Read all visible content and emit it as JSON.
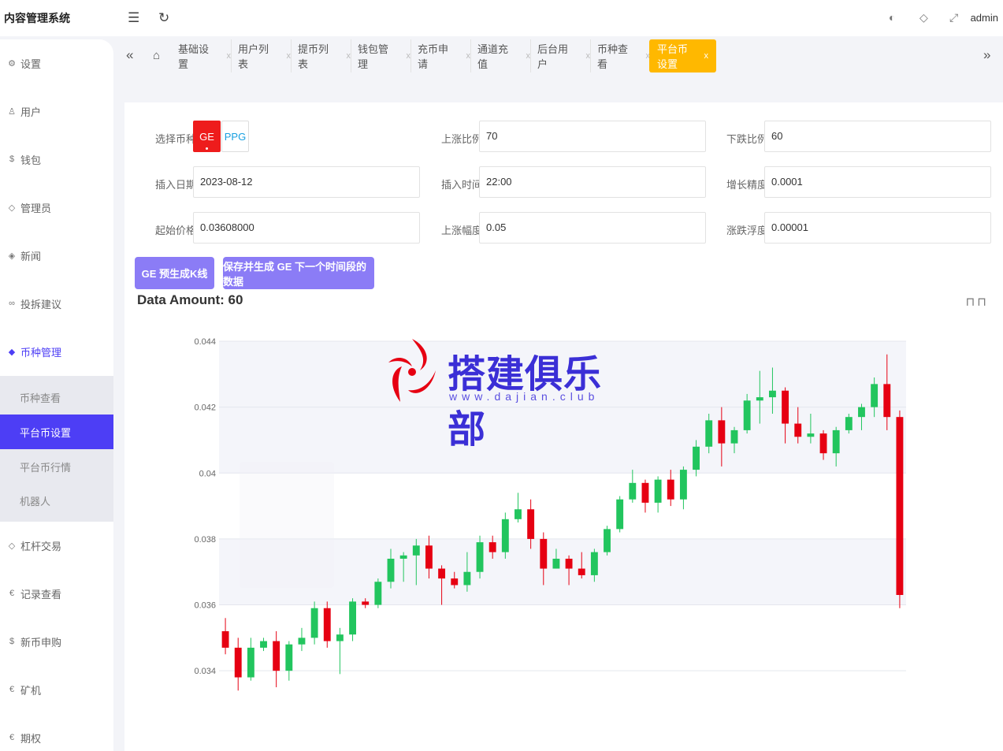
{
  "header": {
    "brand": "内容管理系统",
    "menu_icon": "☰",
    "refresh_icon": "↻",
    "user": "admin"
  },
  "sidebar": {
    "items": [
      {
        "label": "设置",
        "icon": "gear-icon",
        "glyph": "⚙"
      },
      {
        "label": "用户",
        "icon": "user-icon",
        "glyph": "♙"
      },
      {
        "label": "钱包",
        "icon": "wallet-icon",
        "glyph": "$"
      },
      {
        "label": "管理员",
        "icon": "shield-icon",
        "glyph": "◇"
      },
      {
        "label": "新闻",
        "icon": "tag-icon",
        "glyph": "◈"
      },
      {
        "label": "投拆建议",
        "icon": "link-icon",
        "glyph": "∞"
      },
      {
        "label": "币种管理",
        "icon": "diamond-icon",
        "glyph": "◆"
      },
      {
        "label": "杠杆交易",
        "icon": "diamond-outline-icon",
        "glyph": "◇"
      },
      {
        "label": "记录查看",
        "icon": "coin-icon",
        "glyph": "€"
      },
      {
        "label": "新币申购",
        "icon": "dollar-icon",
        "glyph": "$"
      },
      {
        "label": "矿机",
        "icon": "coin-icon",
        "glyph": "€"
      },
      {
        "label": "期权",
        "icon": "coin-icon",
        "glyph": "€"
      }
    ],
    "submenu": [
      "币种查看",
      "平台币设置",
      "平台币行情",
      "机器人"
    ]
  },
  "tabs": [
    "基础设置",
    "用户列表",
    "提币列表",
    "钱包管理",
    "充币申请",
    "通道充值",
    "后台用户",
    "币种查看",
    "平台币设置"
  ],
  "form": {
    "coin_label": "选择币种",
    "coin_ge": "GE",
    "coin_ppg": "PPG",
    "up_ratio_label": "上涨比例",
    "up_ratio": "70",
    "down_ratio_label": "下跌比例",
    "down_ratio": "60",
    "date_label": "插入日期",
    "date": "2023-08-12",
    "time_label": "插入时间",
    "time": "22:00",
    "precision_label": "增长精度",
    "precision": "0.0001",
    "start_price_label": "起始价格",
    "start_price": "0.03608000",
    "rise_label": "上涨幅度",
    "rise": "0.05",
    "float_label": "涨跌浮度",
    "float": "0.00001"
  },
  "buttons": {
    "pre_generate": "GE 预生成K线",
    "save_generate": "保存并生成 GE 下一个时间段的数据"
  },
  "data_amount": "Data Amount: 60",
  "watermark": {
    "text": "搭建俱乐部",
    "url": "www.dajian.club"
  },
  "colors": {
    "accent": "#4d3ef5",
    "tab_active": "#ffb800",
    "up": "#22c55e",
    "down": "#e60012",
    "button": "#8b7cf6"
  },
  "chart_data": {
    "type": "candlestick",
    "ylim": [
      0.033,
      0.044
    ],
    "y_ticks": [
      "0.044",
      "0.042",
      "0.04",
      "0.038",
      "0.036",
      "0.034"
    ],
    "candles": [
      {
        "o": 0.0352,
        "c": 0.0347,
        "h": 0.0356,
        "l": 0.0345
      },
      {
        "o": 0.0347,
        "c": 0.0338,
        "h": 0.035,
        "l": 0.0334
      },
      {
        "o": 0.0338,
        "c": 0.0347,
        "h": 0.035,
        "l": 0.0337
      },
      {
        "o": 0.0347,
        "c": 0.0349,
        "h": 0.035,
        "l": 0.0346
      },
      {
        "o": 0.0349,
        "c": 0.034,
        "h": 0.0352,
        "l": 0.0335
      },
      {
        "o": 0.034,
        "c": 0.0348,
        "h": 0.0349,
        "l": 0.0337
      },
      {
        "o": 0.0348,
        "c": 0.035,
        "h": 0.0353,
        "l": 0.0346
      },
      {
        "o": 0.035,
        "c": 0.0359,
        "h": 0.0361,
        "l": 0.0348
      },
      {
        "o": 0.0359,
        "c": 0.0349,
        "h": 0.0361,
        "l": 0.0347
      },
      {
        "o": 0.0349,
        "c": 0.0351,
        "h": 0.0353,
        "l": 0.0339
      },
      {
        "o": 0.0351,
        "c": 0.0361,
        "h": 0.0362,
        "l": 0.0349
      },
      {
        "o": 0.0361,
        "c": 0.036,
        "h": 0.0362,
        "l": 0.0359
      },
      {
        "o": 0.036,
        "c": 0.0367,
        "h": 0.0368,
        "l": 0.0359
      },
      {
        "o": 0.0367,
        "c": 0.0374,
        "h": 0.0377,
        "l": 0.0365
      },
      {
        "o": 0.0374,
        "c": 0.0375,
        "h": 0.0376,
        "l": 0.0367
      },
      {
        "o": 0.0375,
        "c": 0.0378,
        "h": 0.038,
        "l": 0.0366
      },
      {
        "o": 0.0378,
        "c": 0.0371,
        "h": 0.0381,
        "l": 0.0368
      },
      {
        "o": 0.0371,
        "c": 0.0368,
        "h": 0.0372,
        "l": 0.036
      },
      {
        "o": 0.0368,
        "c": 0.0366,
        "h": 0.037,
        "l": 0.0365
      },
      {
        "o": 0.0366,
        "c": 0.037,
        "h": 0.0376,
        "l": 0.0364
      },
      {
        "o": 0.037,
        "c": 0.0379,
        "h": 0.0381,
        "l": 0.0368
      },
      {
        "o": 0.0379,
        "c": 0.0376,
        "h": 0.0381,
        "l": 0.0374
      },
      {
        "o": 0.0376,
        "c": 0.0386,
        "h": 0.0388,
        "l": 0.0374
      },
      {
        "o": 0.0386,
        "c": 0.0389,
        "h": 0.0394,
        "l": 0.0385
      },
      {
        "o": 0.0389,
        "c": 0.038,
        "h": 0.0392,
        "l": 0.0377
      },
      {
        "o": 0.038,
        "c": 0.0371,
        "h": 0.0382,
        "l": 0.0366
      },
      {
        "o": 0.0371,
        "c": 0.0374,
        "h": 0.0377,
        "l": 0.0371
      },
      {
        "o": 0.0374,
        "c": 0.0371,
        "h": 0.0375,
        "l": 0.0366
      },
      {
        "o": 0.0371,
        "c": 0.0369,
        "h": 0.0376,
        "l": 0.0368
      },
      {
        "o": 0.0369,
        "c": 0.0376,
        "h": 0.0377,
        "l": 0.0367
      },
      {
        "o": 0.0376,
        "c": 0.0383,
        "h": 0.0384,
        "l": 0.0375
      },
      {
        "o": 0.0383,
        "c": 0.0392,
        "h": 0.0393,
        "l": 0.0382
      },
      {
        "o": 0.0392,
        "c": 0.0397,
        "h": 0.0401,
        "l": 0.0391
      },
      {
        "o": 0.0397,
        "c": 0.0391,
        "h": 0.0398,
        "l": 0.0388
      },
      {
        "o": 0.0391,
        "c": 0.0398,
        "h": 0.0399,
        "l": 0.0388
      },
      {
        "o": 0.0398,
        "c": 0.0392,
        "h": 0.0401,
        "l": 0.039
      },
      {
        "o": 0.0392,
        "c": 0.0401,
        "h": 0.0402,
        "l": 0.0389
      },
      {
        "o": 0.0401,
        "c": 0.0408,
        "h": 0.041,
        "l": 0.0399
      },
      {
        "o": 0.0408,
        "c": 0.0416,
        "h": 0.0418,
        "l": 0.0406
      },
      {
        "o": 0.0416,
        "c": 0.0409,
        "h": 0.042,
        "l": 0.0402
      },
      {
        "o": 0.0409,
        "c": 0.0413,
        "h": 0.0414,
        "l": 0.0406
      },
      {
        "o": 0.0413,
        "c": 0.0422,
        "h": 0.0424,
        "l": 0.0412
      },
      {
        "o": 0.0422,
        "c": 0.0423,
        "h": 0.0431,
        "l": 0.0415
      },
      {
        "o": 0.0423,
        "c": 0.0425,
        "h": 0.0432,
        "l": 0.0418
      },
      {
        "o": 0.0425,
        "c": 0.0415,
        "h": 0.0426,
        "l": 0.0409
      },
      {
        "o": 0.0415,
        "c": 0.0411,
        "h": 0.042,
        "l": 0.0409
      },
      {
        "o": 0.0411,
        "c": 0.0412,
        "h": 0.0418,
        "l": 0.0409
      },
      {
        "o": 0.0412,
        "c": 0.0406,
        "h": 0.0413,
        "l": 0.0404
      },
      {
        "o": 0.0406,
        "c": 0.0413,
        "h": 0.0414,
        "l": 0.0402
      },
      {
        "o": 0.0413,
        "c": 0.0417,
        "h": 0.0418,
        "l": 0.0412
      },
      {
        "o": 0.0417,
        "c": 0.042,
        "h": 0.0421,
        "l": 0.0413
      },
      {
        "o": 0.042,
        "c": 0.0427,
        "h": 0.0429,
        "l": 0.0417
      },
      {
        "o": 0.0427,
        "c": 0.0417,
        "h": 0.0436,
        "l": 0.0413
      },
      {
        "o": 0.0417,
        "c": 0.0363,
        "h": 0.0419,
        "l": 0.0359
      }
    ]
  }
}
